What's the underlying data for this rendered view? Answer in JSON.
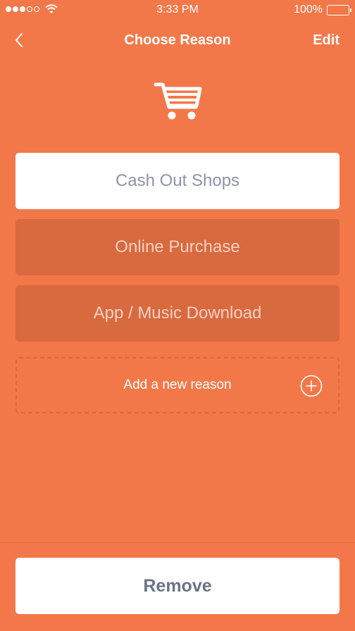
{
  "status_bar": {
    "time": "3:33 PM",
    "battery_text": "100%",
    "signal_dots_filled": 3,
    "signal_dots_total": 5
  },
  "nav": {
    "title": "Choose Reason",
    "edit_label": "Edit",
    "back_icon": "chevron-left-icon"
  },
  "header_icon": "shopping-cart-icon",
  "reasons": [
    {
      "label": "Cash Out Shops",
      "selected": true
    },
    {
      "label": "Online Purchase",
      "selected": false
    },
    {
      "label": "App / Music Download",
      "selected": false
    }
  ],
  "add_reason": {
    "label": "Add a new reason",
    "icon": "plus-circle-icon"
  },
  "footer": {
    "remove_label": "Remove"
  },
  "colors": {
    "background": "#f2784a",
    "unselected_button": "#d9693e",
    "selected_text": "#8b94a6",
    "remove_text": "#6a7488"
  }
}
